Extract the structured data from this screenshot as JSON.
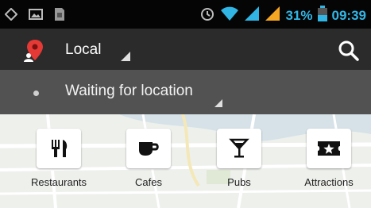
{
  "status_bar": {
    "battery_percent": "31%",
    "time": "09:39",
    "icons": [
      "location-icon",
      "image-icon",
      "sim-icon",
      "alarm-icon",
      "wifi-icon",
      "signal-icon",
      "signal-icon",
      "battery-icon"
    ]
  },
  "action_bar": {
    "location_label": "Local",
    "icons": [
      "map-pin-icon",
      "dropdown-arrow-icon",
      "search-icon"
    ]
  },
  "location_bar": {
    "label": "Waiting for location"
  },
  "categories": [
    {
      "label": "Restaurants",
      "icon": "fork-knife-icon"
    },
    {
      "label": "Cafes",
      "icon": "coffee-cup-icon"
    },
    {
      "label": "Pubs",
      "icon": "cocktail-glass-icon"
    },
    {
      "label": "Attractions",
      "icon": "ticket-star-icon"
    }
  ],
  "colors": {
    "accent": "#31b5e5",
    "pin_red": "#e53935",
    "action_bar": "#2b2b2b",
    "location_bar": "#525252",
    "signal_orange": "#f5a623"
  }
}
